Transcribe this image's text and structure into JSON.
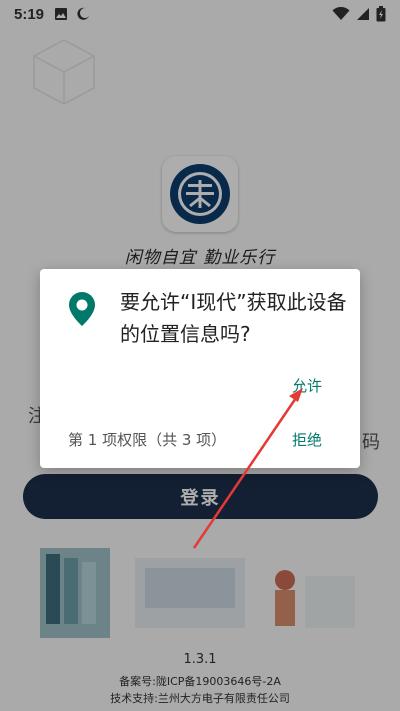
{
  "status_bar": {
    "time": "5:19"
  },
  "app": {
    "slogan": "闲物自宜  勤业乐行",
    "hint_left": "注",
    "hint_right": "码",
    "login_label": "登录",
    "version": "1.3.1",
    "icp": "备案号:陇ICP备19003646号-2A",
    "support": "技术支持:兰州大方电子有限责任公司"
  },
  "dialog": {
    "message": "要允许“I现代”获取此设备的位置信息吗?",
    "allow_label": "允许",
    "deny_label": "拒绝",
    "permission_count": "第 1 项权限（共 3 项）"
  },
  "colors": {
    "accent": "#00796b",
    "login_button": "#1c2f4a",
    "annotation": "#e53935"
  },
  "icons": [
    "image-icon",
    "moon-icon",
    "wifi-icon",
    "battery-icon",
    "location-pin-icon",
    "app-logo-icon"
  ]
}
